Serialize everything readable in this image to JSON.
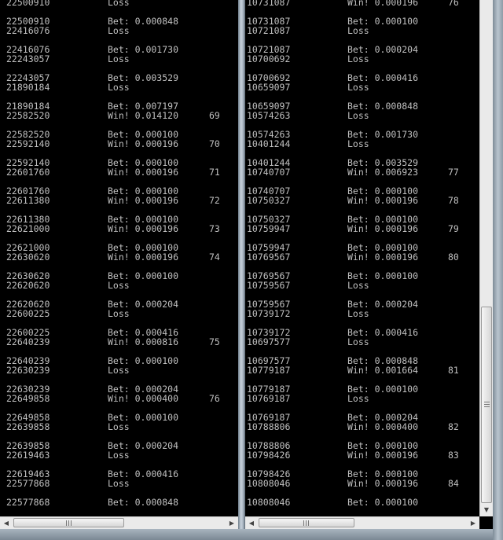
{
  "left_console": {
    "rows": [
      [
        "22500910",
        "Loss",
        ""
      ],
      [
        "",
        "",
        ""
      ],
      [
        "22500910",
        "Bet: 0.000848",
        ""
      ],
      [
        "22416076",
        "Loss",
        ""
      ],
      [
        "",
        "",
        ""
      ],
      [
        "22416076",
        "Bet: 0.001730",
        ""
      ],
      [
        "22243057",
        "Loss",
        ""
      ],
      [
        "",
        "",
        ""
      ],
      [
        "22243057",
        "Bet: 0.003529",
        ""
      ],
      [
        "21890184",
        "Loss",
        ""
      ],
      [
        "",
        "",
        ""
      ],
      [
        "21890184",
        "Bet: 0.007197",
        ""
      ],
      [
        "22582520",
        "Win! 0.014120",
        "69"
      ],
      [
        "",
        "",
        ""
      ],
      [
        "22582520",
        "Bet: 0.000100",
        ""
      ],
      [
        "22592140",
        "Win! 0.000196",
        "70"
      ],
      [
        "",
        "",
        ""
      ],
      [
        "22592140",
        "Bet: 0.000100",
        ""
      ],
      [
        "22601760",
        "Win! 0.000196",
        "71"
      ],
      [
        "",
        "",
        ""
      ],
      [
        "22601760",
        "Bet: 0.000100",
        ""
      ],
      [
        "22611380",
        "Win! 0.000196",
        "72"
      ],
      [
        "",
        "",
        ""
      ],
      [
        "22611380",
        "Bet: 0.000100",
        ""
      ],
      [
        "22621000",
        "Win! 0.000196",
        "73"
      ],
      [
        "",
        "",
        ""
      ],
      [
        "22621000",
        "Bet: 0.000100",
        ""
      ],
      [
        "22630620",
        "Win! 0.000196",
        "74"
      ],
      [
        "",
        "",
        ""
      ],
      [
        "22630620",
        "Bet: 0.000100",
        ""
      ],
      [
        "22620620",
        "Loss",
        ""
      ],
      [
        "",
        "",
        ""
      ],
      [
        "22620620",
        "Bet: 0.000204",
        ""
      ],
      [
        "22600225",
        "Loss",
        ""
      ],
      [
        "",
        "",
        ""
      ],
      [
        "22600225",
        "Bet: 0.000416",
        ""
      ],
      [
        "22640239",
        "Win! 0.000816",
        "75"
      ],
      [
        "",
        "",
        ""
      ],
      [
        "22640239",
        "Bet: 0.000100",
        ""
      ],
      [
        "22630239",
        "Loss",
        ""
      ],
      [
        "",
        "",
        ""
      ],
      [
        "22630239",
        "Bet: 0.000204",
        ""
      ],
      [
        "22649858",
        "Win! 0.000400",
        "76"
      ],
      [
        "",
        "",
        ""
      ],
      [
        "22649858",
        "Bet: 0.000100",
        ""
      ],
      [
        "22639858",
        "Loss",
        ""
      ],
      [
        "",
        "",
        ""
      ],
      [
        "22639858",
        "Bet: 0.000204",
        ""
      ],
      [
        "22619463",
        "Loss",
        ""
      ],
      [
        "",
        "",
        ""
      ],
      [
        "22619463",
        "Bet: 0.000416",
        ""
      ],
      [
        "22577868",
        "Loss",
        ""
      ],
      [
        "",
        "",
        ""
      ],
      [
        "22577868",
        "Bet: 0.000848",
        ""
      ]
    ]
  },
  "right_console": {
    "rows": [
      [
        "10731087",
        "Win! 0.000196",
        "76"
      ],
      [
        "",
        "",
        ""
      ],
      [
        "10731087",
        "Bet: 0.000100",
        ""
      ],
      [
        "10721087",
        "Loss",
        ""
      ],
      [
        "",
        "",
        ""
      ],
      [
        "10721087",
        "Bet: 0.000204",
        ""
      ],
      [
        "10700692",
        "Loss",
        ""
      ],
      [
        "",
        "",
        ""
      ],
      [
        "10700692",
        "Bet: 0.000416",
        ""
      ],
      [
        "10659097",
        "Loss",
        ""
      ],
      [
        "",
        "",
        ""
      ],
      [
        "10659097",
        "Bet: 0.000848",
        ""
      ],
      [
        "10574263",
        "Loss",
        ""
      ],
      [
        "",
        "",
        ""
      ],
      [
        "10574263",
        "Bet: 0.001730",
        ""
      ],
      [
        "10401244",
        "Loss",
        ""
      ],
      [
        "",
        "",
        ""
      ],
      [
        "10401244",
        "Bet: 0.003529",
        ""
      ],
      [
        "10740707",
        "Win! 0.006923",
        "77"
      ],
      [
        "",
        "",
        ""
      ],
      [
        "10740707",
        "Bet: 0.000100",
        ""
      ],
      [
        "10750327",
        "Win! 0.000196",
        "78"
      ],
      [
        "",
        "",
        ""
      ],
      [
        "10750327",
        "Bet: 0.000100",
        ""
      ],
      [
        "10759947",
        "Win! 0.000196",
        "79"
      ],
      [
        "",
        "",
        ""
      ],
      [
        "10759947",
        "Bet: 0.000100",
        ""
      ],
      [
        "10769567",
        "Win! 0.000196",
        "80"
      ],
      [
        "",
        "",
        ""
      ],
      [
        "10769567",
        "Bet: 0.000100",
        ""
      ],
      [
        "10759567",
        "Loss",
        ""
      ],
      [
        "",
        "",
        ""
      ],
      [
        "10759567",
        "Bet: 0.000204",
        ""
      ],
      [
        "10739172",
        "Loss",
        ""
      ],
      [
        "",
        "",
        ""
      ],
      [
        "10739172",
        "Bet: 0.000416",
        ""
      ],
      [
        "10697577",
        "Loss",
        ""
      ],
      [
        "",
        "",
        ""
      ],
      [
        "10697577",
        "Bet: 0.000848",
        ""
      ],
      [
        "10779187",
        "Win! 0.001664",
        "81"
      ],
      [
        "",
        "",
        ""
      ],
      [
        "10779187",
        "Bet: 0.000100",
        ""
      ],
      [
        "10769187",
        "Loss",
        ""
      ],
      [
        "",
        "",
        ""
      ],
      [
        "10769187",
        "Bet: 0.000204",
        ""
      ],
      [
        "10788806",
        "Win! 0.000400",
        "82"
      ],
      [
        "",
        "",
        ""
      ],
      [
        "10788806",
        "Bet: 0.000100",
        ""
      ],
      [
        "10798426",
        "Win! 0.000196",
        "83"
      ],
      [
        "",
        "",
        ""
      ],
      [
        "10798426",
        "Bet: 0.000100",
        ""
      ],
      [
        "10808046",
        "Win! 0.000196",
        "84"
      ],
      [
        "",
        "",
        ""
      ],
      [
        "10808046",
        "Bet: 0.000100",
        ""
      ]
    ]
  },
  "scrollbars": {
    "left_arrow_icon": "◀",
    "right_arrow_icon": "▶",
    "down_arrow_icon": "▼"
  },
  "colors": {
    "console_bg": "#000000",
    "console_text": "#c0c0c0"
  }
}
